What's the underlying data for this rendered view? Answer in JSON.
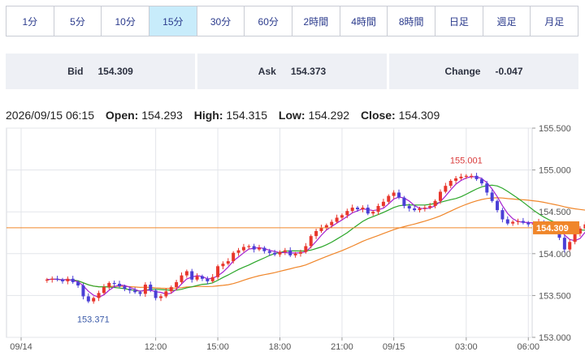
{
  "tabs": [
    "1分",
    "5分",
    "10分",
    "15分",
    "30分",
    "60分",
    "2時間",
    "4時間",
    "8時間",
    "日足",
    "週足",
    "月足"
  ],
  "active_tab": "15分",
  "quotes": {
    "bid_label": "Bid",
    "bid_value": "154.309",
    "ask_label": "Ask",
    "ask_value": "154.373",
    "change_label": "Change",
    "change_value": "-0.047"
  },
  "ohlc": {
    "datetime": "2026/09/15 06:15",
    "open_label": "Open:",
    "open": "154.293",
    "high_label": "High:",
    "high": "154.315",
    "low_label": "Low:",
    "low": "154.292",
    "close_label": "Close:",
    "close": "154.309"
  },
  "chart_data": {
    "type": "candlestick",
    "title": "",
    "xlabel": "",
    "ylabel": "",
    "ylim": [
      153.0,
      155.5
    ],
    "yticks": [
      "153.000",
      "153.500",
      "154.000",
      "154.500",
      "155.000",
      "155.500"
    ],
    "xticks": [
      {
        "label": "09/14",
        "hour": 5.5
      },
      {
        "label": "12:00",
        "hour": 12
      },
      {
        "label": "15:00",
        "hour": 15
      },
      {
        "label": "18:00",
        "hour": 18
      },
      {
        "label": "21:00",
        "hour": 21
      },
      {
        "label": "09/15",
        "hour": 23.5
      },
      {
        "label": "03:00",
        "hour": 27
      },
      {
        "label": "06:00",
        "hour": 30
      }
    ],
    "start_hour": 6.75,
    "interval_hours": 0.25,
    "current_price": 154.309,
    "current_price_label": "154.309",
    "high_annotation": {
      "label": "155.001",
      "value": 155.001
    },
    "low_annotation": {
      "label": "153.371",
      "value": 153.371
    },
    "colors": {
      "up": "#e8362c",
      "down": "#4a3fd6",
      "ma_fast": "#a41fd0",
      "ma_mid": "#2aa628",
      "ma_slow": "#f0862a",
      "price_line": "#f0862a",
      "price_box": "#f0862a"
    },
    "closes": [
      153.69,
      153.7,
      153.69,
      153.67,
      153.7,
      153.66,
      153.62,
      153.49,
      153.43,
      153.47,
      153.53,
      153.6,
      153.65,
      153.64,
      153.61,
      153.58,
      153.56,
      153.54,
      153.52,
      153.63,
      153.56,
      153.47,
      153.49,
      153.55,
      153.6,
      153.66,
      153.74,
      153.79,
      153.69,
      153.73,
      153.7,
      153.67,
      153.72,
      153.85,
      153.88,
      153.91,
      154.01,
      154.04,
      154.08,
      154.09,
      154.05,
      154.07,
      154.03,
      154.01,
      153.99,
      154.02,
      154.04,
      153.98,
      154.0,
      154.02,
      154.09,
      154.21,
      154.27,
      154.31,
      154.34,
      154.38,
      154.43,
      154.46,
      154.51,
      154.55,
      154.53,
      154.55,
      154.48,
      154.5,
      154.57,
      154.62,
      154.69,
      154.73,
      154.67,
      154.57,
      154.54,
      154.52,
      154.54,
      154.55,
      154.57,
      154.63,
      154.74,
      154.81,
      154.87,
      154.9,
      154.92,
      154.93,
      154.93,
      154.89,
      154.84,
      154.73,
      154.63,
      154.52,
      154.41,
      154.36,
      154.38,
      154.39,
      154.37,
      154.35,
      154.36,
      154.38,
      154.36,
      154.35,
      154.3,
      154.19,
      154.05,
      154.14,
      154.24,
      154.3,
      154.35,
      154.37,
      154.38,
      154.36,
      154.37,
      154.31
    ]
  }
}
